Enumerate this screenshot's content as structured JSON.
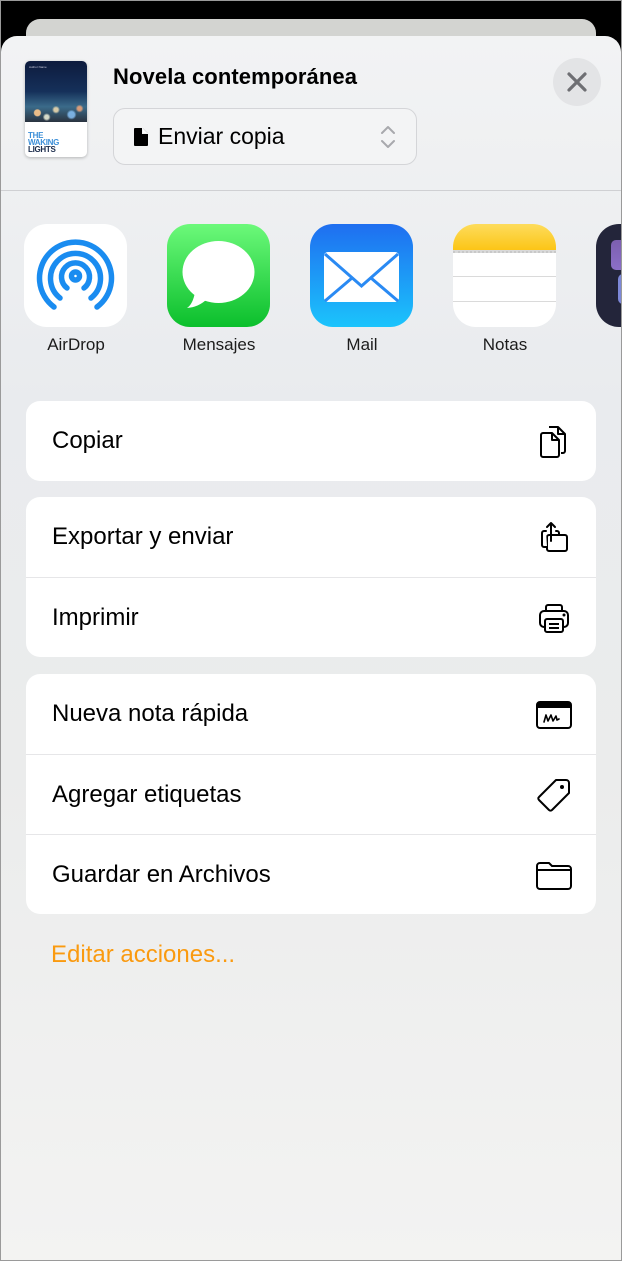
{
  "sheet": {
    "title": "Novela contemporánea",
    "thumbnail": {
      "author": "Author Name",
      "title_lines": [
        "THE",
        "WAKING",
        "LIGHTS"
      ]
    },
    "send_mode": {
      "selected": "Enviar copia",
      "icon": "doc-fill-icon",
      "chevron_icon": "chevron-up-down-icon"
    },
    "close_icon": "xmark-icon"
  },
  "apps": [
    {
      "name": "AirDrop",
      "icon": "airdrop-icon"
    },
    {
      "name": "Mensajes",
      "icon": "messages-icon"
    },
    {
      "name": "Mail",
      "icon": "mail-icon"
    },
    {
      "name": "Notas",
      "icon": "notes-icon"
    },
    {
      "name": "",
      "icon": "partial-app-icon"
    }
  ],
  "action_groups": [
    {
      "items": [
        {
          "label": "Copiar",
          "icon": "copy-docs-icon"
        }
      ]
    },
    {
      "items": [
        {
          "label": "Exportar y enviar",
          "icon": "share-export-icon"
        },
        {
          "label": "Imprimir",
          "icon": "printer-icon"
        }
      ]
    },
    {
      "items": [
        {
          "label": "Nueva nota rápida",
          "icon": "quick-note-icon"
        },
        {
          "label": "Agregar etiquetas",
          "icon": "tag-icon"
        },
        {
          "label": "Guardar en Archivos",
          "icon": "folder-icon"
        }
      ]
    }
  ],
  "edit_actions": "Editar acciones...",
  "colors": {
    "accent": "#fa9a0f",
    "airdrop_blue": "#1a8cf0",
    "close_bg": "#e3e4e6"
  }
}
